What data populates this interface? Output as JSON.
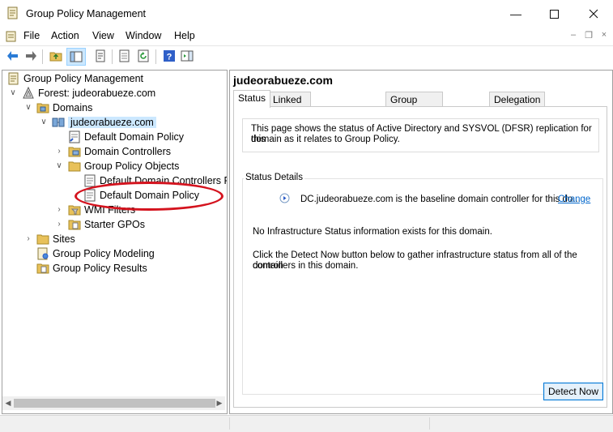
{
  "window": {
    "title": "Group Policy Management",
    "icon": "gpmc-icon",
    "controls": [
      "minimize",
      "maximize",
      "close"
    ]
  },
  "menu": {
    "items": [
      "File",
      "Action",
      "View",
      "Window",
      "Help"
    ]
  },
  "toolbar": {
    "icons": [
      "back-arrow-icon",
      "forward-arrow-icon",
      "up-folder-icon",
      "show-tree-icon",
      "properties-icon",
      "export-list-icon",
      "refresh-icon",
      "help-icon",
      "action-pane-icon"
    ]
  },
  "tree": {
    "root": "Group Policy Management",
    "forest": "Forest: judeorabueze.com",
    "domains": "Domains",
    "domain": "judeorabueze.com",
    "default_domain_policy_link": "Default Domain Policy",
    "domain_controllers": "Domain Controllers",
    "gpo_container": "Group Policy Objects",
    "gpo_dc_policy": "Default Domain Controllers P",
    "gpo_default_policy": "Default Domain Policy",
    "wmi_filters": "WMI Filters",
    "starter_gpos": "Starter GPOs",
    "sites": "Sites",
    "modeling": "Group Policy Modeling",
    "results": "Group Policy Results"
  },
  "right": {
    "title": "judeorabueze.com",
    "tabs": [
      "Status",
      "Linked Group Policy Objects",
      "Group Policy Inheritance",
      "Delegation"
    ],
    "active_tab": "Status",
    "info_line1": "This page shows the status of Active Directory and SYSVOL (DFSR) replication for this",
    "info_line2": "domain as it relates to Group Policy.",
    "status_details_label": "Status Details",
    "baseline_text": "DC.judeorabueze.com is the baseline domain controller for this do...",
    "change_link": "Change",
    "no_info": "No Infrastructure Status information exists for this domain.",
    "detect_line1": "Click the Detect Now button below to gather infrastructure status from all of the domain",
    "detect_line2": "controllers in this domain.",
    "detect_button": "Detect Now"
  },
  "colors": {
    "selection": "#cce8ff",
    "annotation": "#d4131e",
    "link": "#0066cc"
  }
}
